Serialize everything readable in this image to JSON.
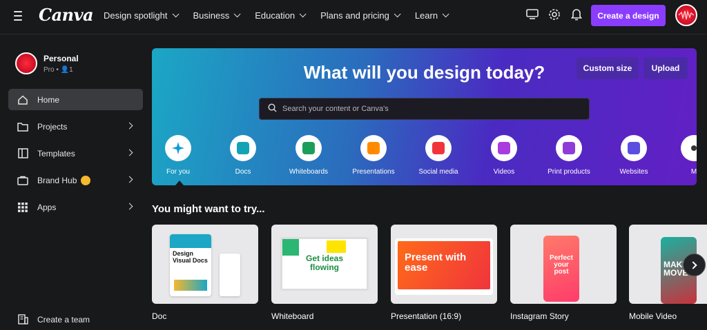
{
  "brand": {
    "logo": "Canva",
    "accent": "#8b3dff"
  },
  "nav": {
    "items": [
      {
        "label": "Design spotlight"
      },
      {
        "label": "Business"
      },
      {
        "label": "Education"
      },
      {
        "label": "Plans and pricing"
      },
      {
        "label": "Learn"
      }
    ],
    "create_label": "Create a design"
  },
  "sidebar": {
    "profile": {
      "name": "Personal",
      "plan": "Pro",
      "members": "1"
    },
    "items": [
      {
        "label": "Home",
        "icon": "home-icon"
      },
      {
        "label": "Projects",
        "icon": "folder-icon"
      },
      {
        "label": "Templates",
        "icon": "template-icon"
      },
      {
        "label": "Brand Hub",
        "icon": "brand-icon"
      },
      {
        "label": "Apps",
        "icon": "apps-icon"
      }
    ],
    "footer": {
      "label": "Create a team"
    }
  },
  "hero": {
    "title": "What will you design today?",
    "custom_size_label": "Custom size",
    "upload_label": "Upload",
    "search_placeholder": "Search your content or Canva's",
    "categories": [
      {
        "label": "For you",
        "color": "#0f9bd7"
      },
      {
        "label": "Docs",
        "color": "#13a3b5"
      },
      {
        "label": "Whiteboards",
        "color": "#1b9e5a"
      },
      {
        "label": "Presentations",
        "color": "#ff8a00"
      },
      {
        "label": "Social media",
        "color": "#f0343c"
      },
      {
        "label": "Videos",
        "color": "#a93bdf"
      },
      {
        "label": "Print products",
        "color": "#8e3bd8"
      },
      {
        "label": "Websites",
        "color": "#5a4fe0"
      },
      {
        "label": "M",
        "color": "#333333"
      }
    ]
  },
  "suggestions": {
    "title": "You might want to try...",
    "cards": [
      {
        "label": "Doc",
        "preview": "Design Visual Docs"
      },
      {
        "label": "Whiteboard",
        "preview": "Get ideas flowing"
      },
      {
        "label": "Presentation (16:9)",
        "preview": "Present with ease"
      },
      {
        "label": "Instagram Story",
        "preview": "Perfect your post"
      },
      {
        "label": "Mobile Video",
        "preview": "MAKE MOVE"
      }
    ]
  }
}
